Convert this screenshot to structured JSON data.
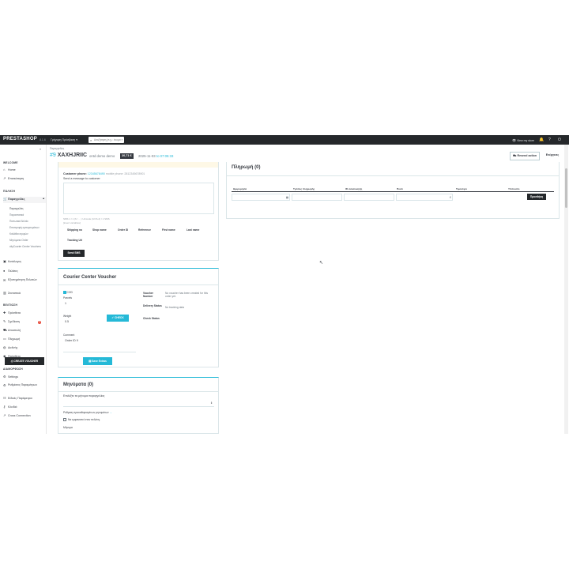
{
  "topbar": {
    "logo": "PRESTASHOP",
    "version": "8.1.6",
    "quick_access": "Γρήγορη Πρόσβαση ▾",
    "search_placeholder": "Αναζήτηση (π.χ.: όνομα προϊόντος, ...",
    "view_store": "View my store"
  },
  "sidebar": {
    "sections": [
      {
        "label": "WELCOME"
      },
      {
        "label": "ΠΩΛΗΣΗ"
      },
      {
        "label": "ΒΕΛΤΙΩΣΗ"
      },
      {
        "label": "ΔΙΑΜΟΡΦΩΣΗ"
      }
    ],
    "items": [
      {
        "label": "Home"
      },
      {
        "label": "Επισκόπηση"
      },
      {
        "label": "Παραγγελίες"
      },
      {
        "label": "Κατάλογος"
      },
      {
        "label": "Πελάτες"
      },
      {
        "label": "Εξυπηρέτηση Πελατών"
      },
      {
        "label": "Στατιστικά"
      },
      {
        "label": "Πρόσθετα"
      },
      {
        "label": "Σχεδίαση"
      },
      {
        "label": "Αποστολή"
      },
      {
        "label": "Πληρωμή"
      },
      {
        "label": "Διεθνής"
      },
      {
        "label": "Πρόσθετο"
      },
      {
        "label": "Settings"
      },
      {
        "label": "Ρυθμίσεις Παραμέτρων"
      },
      {
        "label": "Ειδικές Παράμετροι"
      },
      {
        "label": "Κλειδιά"
      },
      {
        "label": "Cross Connection"
      }
    ],
    "orders_sub": [
      {
        "label": "Παραγγελίες"
      },
      {
        "label": "Παραστατικά"
      },
      {
        "label": "Πιστωτικά δελτία"
      },
      {
        "label": "Επιστροφή εμπορευμάτων"
      },
      {
        "label": "Καλάθια αγορών"
      },
      {
        "label": "Μηνύματα Order"
      },
      {
        "label": "cityCourier Center Vouchers"
      }
    ],
    "badge": "8"
  },
  "header": {
    "breadcrumb": "Παραγγελίες",
    "order_num": "#9",
    "order_ref": "XAXHJRIIC",
    "customer": "ontd demo demo",
    "total": "20,71 €",
    "date": "2025-11-03",
    "time": "to 07:05:33",
    "btn_resend": "Resend action",
    "btn_actions": "Ενέργειες"
  },
  "sms": {
    "customer_phone_label": "Customer phone:",
    "customer_phone_value": "12345678490",
    "mobile_label": "mobile phone:",
    "mobile_value": "2812345678901",
    "send_label": "Send a message to customer",
    "counter": "SMS 1 / 1 (6 / ... ) Unicode (UCS-2) / 1 SMS",
    "variables_label": "[insert variables]",
    "tags": [
      "Shipping no",
      "Shop name",
      "Order ID",
      "Reference",
      "First name",
      "Last name",
      "Tracking Url"
    ],
    "send_button": "Send SMS"
  },
  "courier": {
    "title": "Courier Center Voucher",
    "cod_label": "COD",
    "parcels_label": "Parcels",
    "parcels_value": "1",
    "weight_label": "Weight",
    "weight_value": "0.5",
    "comment_label": "Comment",
    "comment_value": "Order ID 9",
    "voucher_label": "Voucher Number",
    "voucher_value": "No voucher has been created for this order yet.",
    "delivery_label": "Delivery Status",
    "delivery_value": "No tracking data",
    "check_status_label": "Check Status",
    "check_button": "✓ CHECK",
    "create_button": "CREATE VOUCHER",
    "save_button": "Save Extras"
  },
  "messages": {
    "title": "Μηνύματα (0)",
    "select_label": "Επιλέξτε τα μήνυμα παραγγελίας",
    "config_text": "Ρύθμιση προκαθορισμένων μηνυμάτων",
    "config_link": "→",
    "display_label": "Να εμφανιστεί στον πελάτη;",
    "message_label": "Μήνυμα"
  },
  "payment": {
    "title": "Πληρωμή (0)",
    "columns": [
      "Ημερομηνία",
      "Τρόπος πληρωμής",
      "ID συναλλαγής",
      "Ποσό",
      "Τιμολόγιο",
      "Υπόλοιπο"
    ],
    "add_button": "Προσθήκη"
  }
}
